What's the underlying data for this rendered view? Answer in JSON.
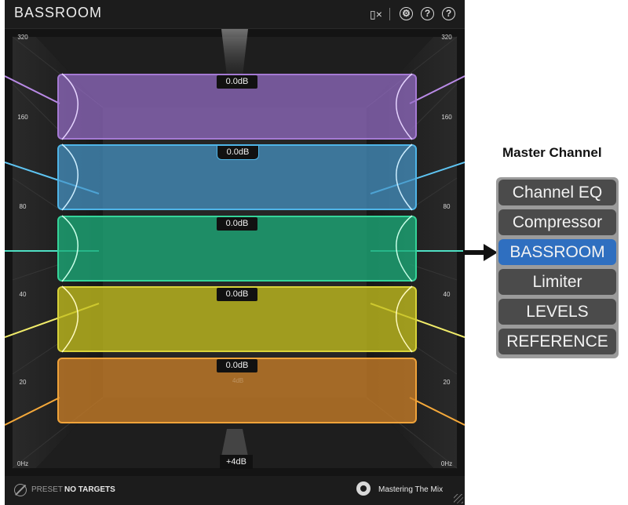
{
  "plugin": {
    "title": "BASSROOM",
    "icons": [
      "mute-icon",
      "gear-icon",
      "help-icon",
      "question-icon"
    ],
    "axis_labels": [
      "320",
      "160",
      "80",
      "40",
      "20",
      "0Hz"
    ],
    "bands": [
      {
        "gain": "0.0dB",
        "color": "#a57ad4"
      },
      {
        "gain": "0.0dB",
        "color": "#4fb5e8"
      },
      {
        "gain": "0.0dB",
        "color": "#35d49a"
      },
      {
        "gain": "0.0dB",
        "color": "#d8d33a"
      },
      {
        "gain": "0.0dB",
        "color": "#f0a33a"
      }
    ],
    "bottom_gain": "+4dB",
    "gain_hint": "4dB",
    "footer": {
      "preset_label": "PRESET",
      "preset_value": "NO TARGETS",
      "brand": "Mastering The Mix"
    }
  },
  "master_channel": {
    "title": "Master Channel",
    "items": [
      {
        "label": "Channel EQ",
        "active": false
      },
      {
        "label": "Compressor",
        "active": false
      },
      {
        "label": "BASSROOM",
        "active": true
      },
      {
        "label": "Limiter",
        "active": false
      },
      {
        "label": "LEVELS",
        "active": false
      },
      {
        "label": "REFERENCE",
        "active": false
      }
    ],
    "accent": "#2f6fc0"
  }
}
